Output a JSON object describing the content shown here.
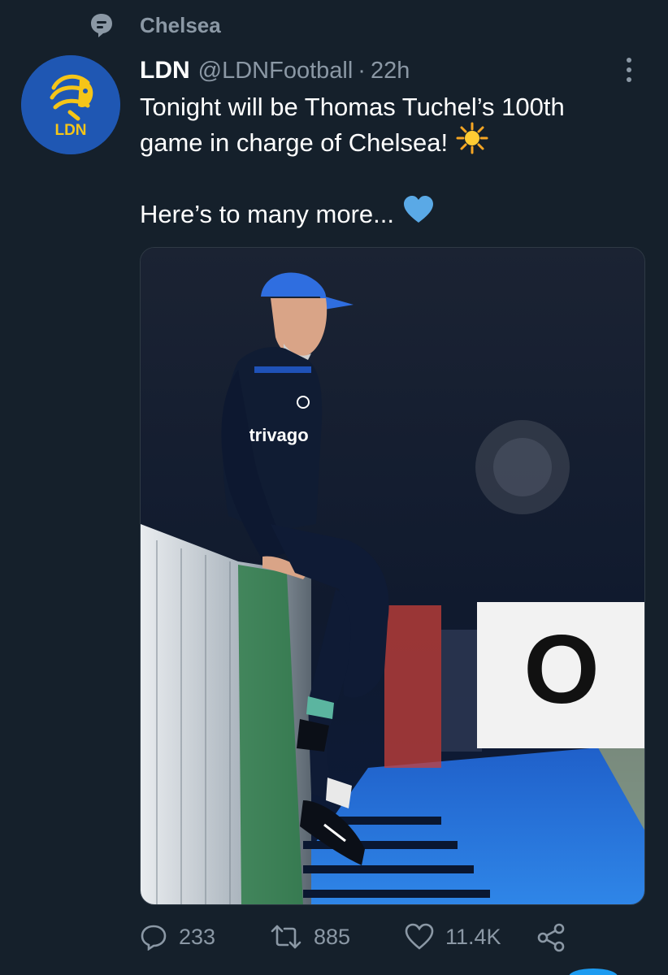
{
  "context": {
    "icon": "topic-icon",
    "label": "Chelsea"
  },
  "author": {
    "avatar_text": "LDN",
    "display_name": "LDN",
    "handle": "@LDNFootball",
    "separator": "·",
    "timestamp": "22h"
  },
  "tweet": {
    "line1": "Tonight will be Thomas Tuchel’s 100th",
    "line2": "game in charge of Chelsea!",
    "line2_emoji": "sun-emoji",
    "line3": "Here’s to many more...",
    "line3_emoji": "blue-heart-emoji"
  },
  "media": {
    "kit_sponsor": "trivago",
    "board_text": "O"
  },
  "actions": {
    "replies": "233",
    "retweets": "885",
    "likes": "11.4K",
    "share_icon": "share-icon"
  },
  "colors": {
    "background": "#15202b",
    "secondary_text": "#8b98a5",
    "avatar_blue": "#1f57b3",
    "avatar_gold": "#f5c518",
    "heart_blue": "#5aa9e6"
  }
}
